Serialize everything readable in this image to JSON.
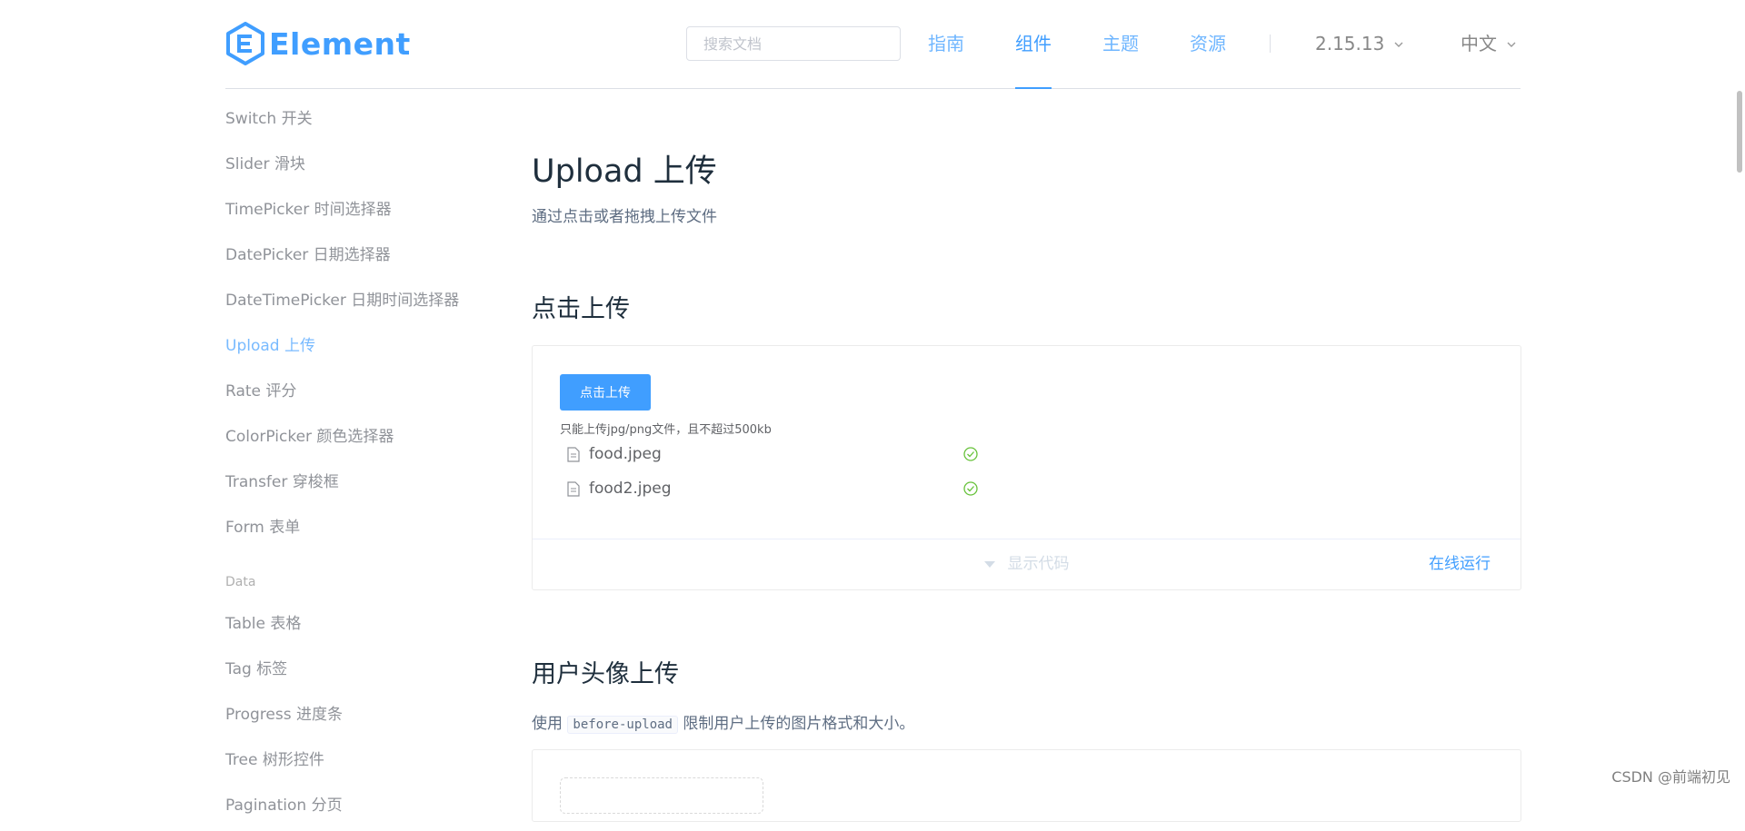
{
  "header": {
    "logo_text": "Element",
    "search_placeholder": "搜索文档",
    "nav": [
      "指南",
      "组件",
      "主题",
      "资源"
    ],
    "version": "2.15.13",
    "language": "中文"
  },
  "sidebar": {
    "items_top": [
      "Switch 开关",
      "Slider 滑块",
      "TimePicker 时间选择器",
      "DatePicker 日期选择器",
      "DateTimePicker 日期时间选择器",
      "Upload 上传",
      "Rate 评分",
      "ColorPicker 颜色选择器",
      "Transfer 穿梭框",
      "Form 表单"
    ],
    "group_label": "Data",
    "items_data": [
      "Table 表格",
      "Tag 标签",
      "Progress 进度条",
      "Tree 树形控件",
      "Pagination 分页"
    ]
  },
  "main": {
    "title": "Upload 上传",
    "description": "通过点击或者拖拽上传文件",
    "section1_title": "点击上传",
    "upload_button": "点击上传",
    "tip": "只能上传jpg/png文件，且不超过500kb",
    "files": [
      "food.jpeg",
      "food2.jpeg"
    ],
    "show_code": "显示代码",
    "run_online": "在线运行",
    "section2_title": "用户头像上传",
    "desc2_prefix": "使用",
    "desc2_code": "before-upload",
    "desc2_suffix": "限制用户上传的图片格式和大小。"
  },
  "watermark": "CSDN @前端初见",
  "colors": {
    "primary": "#409eff",
    "success": "#67c23a"
  }
}
